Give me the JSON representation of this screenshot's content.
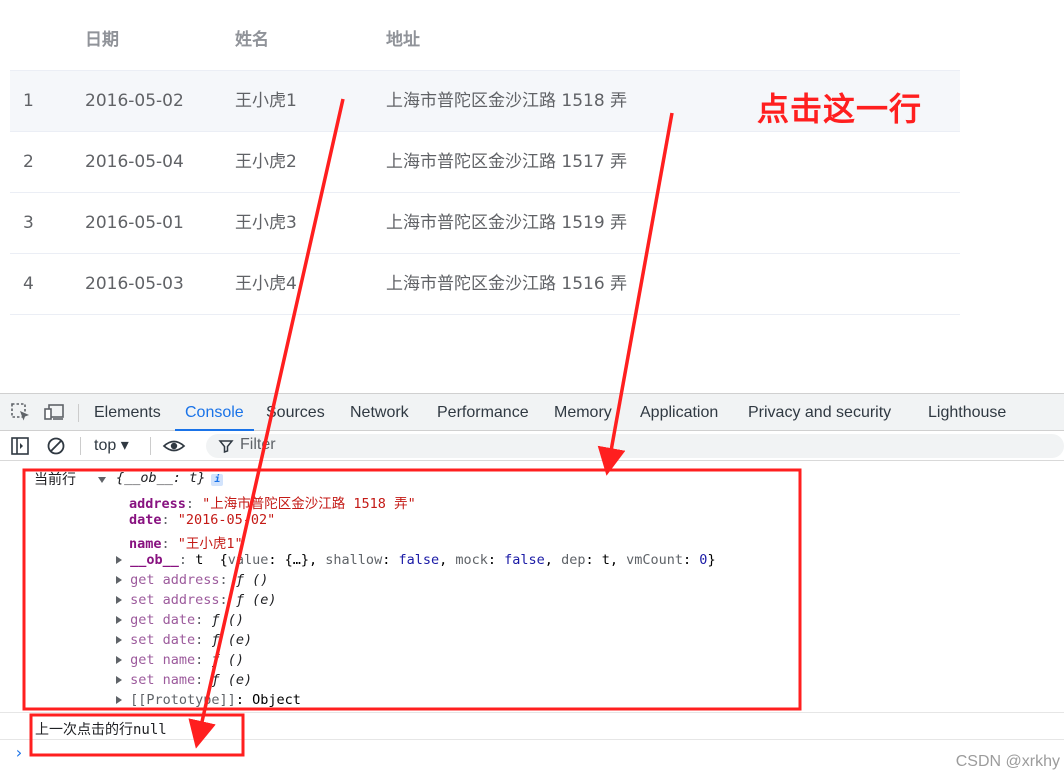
{
  "table": {
    "headers": {
      "index": "",
      "date": "日期",
      "name": "姓名",
      "address": "地址"
    },
    "rows": [
      {
        "index": "1",
        "date": "2016-05-02",
        "name": "王小虎1",
        "address": "上海市普陀区金沙江路 1518 弄"
      },
      {
        "index": "2",
        "date": "2016-05-04",
        "name": "王小虎2",
        "address": "上海市普陀区金沙江路 1517 弄"
      },
      {
        "index": "3",
        "date": "2016-05-01",
        "name": "王小虎3",
        "address": "上海市普陀区金沙江路 1519 弄"
      },
      {
        "index": "4",
        "date": "2016-05-03",
        "name": "王小虎4",
        "address": "上海市普陀区金沙江路 1516 弄"
      }
    ]
  },
  "annotation": {
    "text": "点击这一行",
    "color": "#ff1f1f"
  },
  "devtools": {
    "tabs": [
      "Elements",
      "Console",
      "Sources",
      "Network",
      "Performance",
      "Memory",
      "Application",
      "Privacy and security",
      "Lighthouse"
    ],
    "active_tab": "Console",
    "context": "top ▾",
    "filter_placeholder": "Filter"
  },
  "console": {
    "current_label": "当前行",
    "object_summary": "{__ob__: t}",
    "props": [
      {
        "key": "address",
        "value": "\"上海市普陀区金沙江路 1518 弄\""
      },
      {
        "key": "date",
        "value": "\"2016-05-02\""
      },
      {
        "key": "name",
        "value": "\"王小虎1\""
      }
    ],
    "ob_line": {
      "key": "__ob__",
      "type": "t",
      "detail_open": "{",
      "value_key": "value",
      "value_val": "{…}",
      "shallow_key": "shallow",
      "shallow_val": "false",
      "mock_key": "mock",
      "mock_val": "false",
      "dep_key": "dep",
      "dep_val": "t",
      "vm_key": "vmCount",
      "vm_val": "0",
      "detail_close": "}"
    },
    "accessors": [
      {
        "key": "get address",
        "value": "ƒ ()"
      },
      {
        "key": "set address",
        "value": "ƒ (e)"
      },
      {
        "key": "get date",
        "value": "ƒ ()"
      },
      {
        "key": "set date",
        "value": "ƒ (e)"
      },
      {
        "key": "get name",
        "value": "ƒ ()"
      },
      {
        "key": "set name",
        "value": "ƒ (e)"
      }
    ],
    "prototype": {
      "key": "[[Prototype]]",
      "value": "Object"
    },
    "last_clicked": "上一次点击的行null"
  },
  "watermark": "CSDN @xrkhy",
  "colors": {
    "accent": "#1a73e8",
    "annotation_red": "#ff1f1f",
    "row_highlight": "#f5f7fa"
  }
}
